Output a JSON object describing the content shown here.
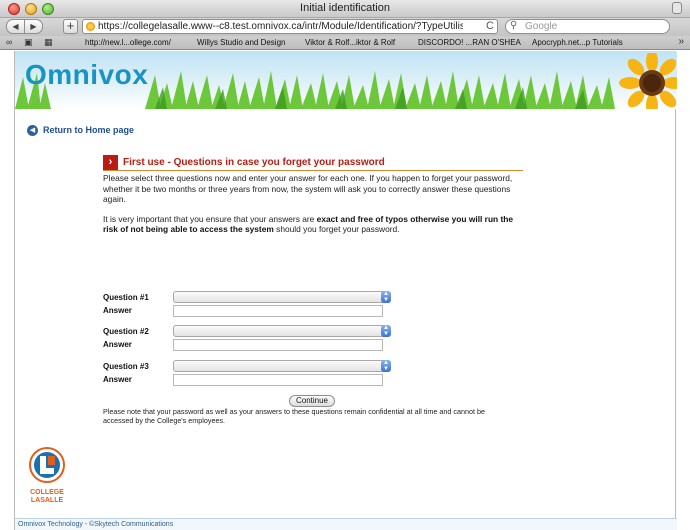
{
  "window": {
    "title": "Initial identification"
  },
  "toolbar": {
    "back_label": "◀",
    "forward_label": "▶",
    "add_label": "+",
    "url": "https://collegelasalle.www--c8.test.omnivox.ca/intr/Module/Identification/?TypeUtilisateur=Et",
    "reload_label": "C",
    "search_placeholder": "Google"
  },
  "bookmarks": {
    "items": [
      "http://new.l...ollege.com/",
      "Willys Studio and Design",
      "Viktor & Rolf...iktor & Rolf",
      "DISCORDO! ...RAN O'SHEA",
      "Apocryph.net...p Tutorials"
    ],
    "more_label": "»"
  },
  "page": {
    "banner_logo": "Omnivox",
    "home_link": "Return to Home page",
    "section_title": "First use - Questions in case you forget your password",
    "intro_text": "Please select three questions now and enter your answer for each one. If you happen to forget your password, whether it be two months or three years from now, the system will ask you to correctly answer these questions again.",
    "warning_pre": "It is very important that you ensure that your answers are ",
    "warning_bold1": "exact and free of typos otherwise you will run the risk of not being able to access the system",
    "warning_post": " should you forget your password.",
    "questions": [
      {
        "label": "Question #1",
        "answer_label": "Answer"
      },
      {
        "label": "Question #2",
        "answer_label": "Answer"
      },
      {
        "label": "Question #3",
        "answer_label": "Answer"
      }
    ],
    "continue_label": "Continue",
    "note": "Please note that your password as well as your answers to these questions remain confidential at all time and cannot be accessed by the College's employees.",
    "college_line1": "COLLEGE",
    "college_line2": "LASALLE",
    "footer": "Omnivox Technology - ©Skytech Communications"
  },
  "icons": {
    "home": "back-arrow-circle-icon",
    "section": "right-arrow-box-icon",
    "select": "dropdown-arrows-icon"
  },
  "colors": {
    "brand": "#1993c4",
    "section_title": "#b71d12",
    "link": "#1d4f8e",
    "college_orange": "#e25e1a"
  }
}
